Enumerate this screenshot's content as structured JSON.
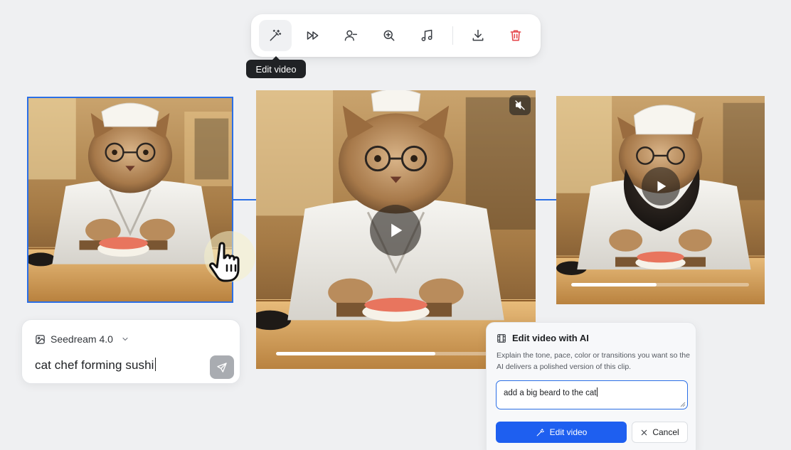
{
  "toolbar": {
    "buttons": [
      {
        "name": "edit-video-button",
        "icon": "magic-wand-icon",
        "active": true
      },
      {
        "name": "fast-forward-button",
        "icon": "fast-forward-icon"
      },
      {
        "name": "remove-person-button",
        "icon": "user-minus-icon"
      },
      {
        "name": "zoom-in-button",
        "icon": "zoom-in-icon"
      },
      {
        "name": "audio-button",
        "icon": "music-note-icon"
      },
      {
        "name": "download-button",
        "icon": "download-icon"
      },
      {
        "name": "delete-button",
        "icon": "trash-icon"
      }
    ],
    "tooltip": "Edit video"
  },
  "clips": {
    "left": {
      "state": "selected"
    },
    "center": {
      "progress": 0.66,
      "muted": true
    },
    "right": {
      "progress": 0.48
    }
  },
  "prompt": {
    "model_label": "Seedream 4.0",
    "model_icon": "image-icon",
    "text": "cat chef forming sushi",
    "send_icon": "send-icon"
  },
  "edit_panel": {
    "title": "Edit video with AI",
    "title_icon": "film-icon",
    "description": "Explain the tone, pace, color or transitions you want so the AI delivers a polished version of this clip.",
    "input_value": "add a big beard to the cat",
    "primary_label": "Edit video",
    "secondary_label": "Cancel"
  },
  "colors": {
    "accent": "#1e5ff0",
    "selection": "#2b6fe6",
    "danger": "#e5484d",
    "background": "#eff0f2"
  }
}
